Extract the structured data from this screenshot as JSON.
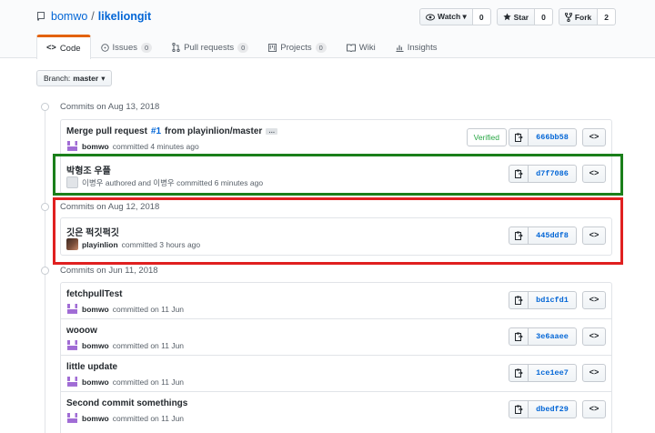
{
  "repo": {
    "owner": "bomwo",
    "separator": "/",
    "name": "likeliongit"
  },
  "actions": [
    {
      "label": "Watch ▾",
      "count": "0",
      "icon": "eye-icon"
    },
    {
      "label": "Star",
      "count": "0",
      "icon": "star-icon"
    },
    {
      "label": "Fork",
      "count": "2",
      "icon": "fork-icon"
    }
  ],
  "tabs": [
    {
      "label": "Code",
      "icon": "code-icon",
      "active": true,
      "count": ""
    },
    {
      "label": "Issues",
      "icon": "issue-icon",
      "count": "0"
    },
    {
      "label": "Pull requests",
      "icon": "pull-request-icon",
      "count": "0"
    },
    {
      "label": "Projects",
      "icon": "project-icon",
      "count": "0"
    },
    {
      "label": "Wiki",
      "icon": "book-icon",
      "count": ""
    },
    {
      "label": "Insights",
      "icon": "graph-icon",
      "count": ""
    }
  ],
  "branch": {
    "prefix": "Branch:",
    "name": "master",
    "caret": "▾"
  },
  "groups": [
    {
      "title": "Commits on Aug 13, 2018",
      "commits": [
        {
          "message_prefix": "Merge pull request ",
          "ref": "#1",
          "message_suffix": " from playinlion/master",
          "has_ellipsis": "…",
          "author": "bomwo",
          "meta": "committed 4 minutes ago",
          "avatar": "purple",
          "verified": "Verified",
          "sha": "666bb58"
        },
        {
          "message_prefix": "박형조 우플",
          "author": "",
          "meta": "이병우 authored and 이병우 committed 6 minutes ago",
          "avatar": "gray",
          "sha": "d7f7086"
        }
      ]
    },
    {
      "title": "Commits on Aug 12, 2018",
      "commits": [
        {
          "message_prefix": "깃은 퍽깃퍽깃",
          "author": "playinlion",
          "meta": "committed 3 hours ago",
          "avatar": "dark",
          "sha": "445ddf8"
        }
      ]
    },
    {
      "title": "Commits on Jun 11, 2018",
      "commits": [
        {
          "message_prefix": "fetchpullTest",
          "author": "bomwo",
          "meta": "committed on 11 Jun",
          "avatar": "purple",
          "sha": "bd1cfd1"
        },
        {
          "message_prefix": "wooow",
          "author": "bomwo",
          "meta": "committed on 11 Jun",
          "avatar": "purple",
          "sha": "3e6aaee"
        },
        {
          "message_prefix": "little update",
          "author": "bomwo",
          "meta": "committed on 11 Jun",
          "avatar": "purple",
          "sha": "1ce1ee7"
        },
        {
          "message_prefix": "Second commit somethings",
          "author": "bomwo",
          "meta": "committed on 11 Jun",
          "avatar": "purple",
          "sha": "dbedf29"
        }
      ]
    }
  ],
  "browse_label": "<>",
  "colors": {
    "link": "#0366d6",
    "active_tab": "#e36209",
    "green_highlight": "#1a7f1a",
    "red_highlight": "#e02020",
    "verified": "#28a745"
  }
}
